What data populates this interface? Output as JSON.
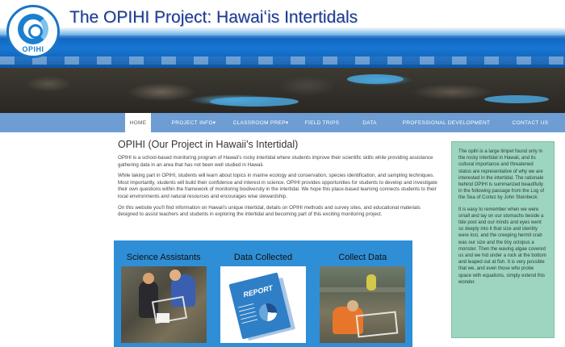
{
  "site": {
    "title": "The OPIHI Project: Hawaiʻis Intertidals",
    "logo_text": "OPIHI"
  },
  "nav": {
    "items": [
      {
        "label": "HOME",
        "active": true
      },
      {
        "label": "PROJECT INFO▾",
        "active": false
      },
      {
        "label": "CLASSROOM PREP▾",
        "active": false
      },
      {
        "label": "FIELD TRIPS",
        "active": false
      },
      {
        "label": "DATA",
        "active": false
      },
      {
        "label": "PROFESSIONAL DEVELOPMENT",
        "active": false
      },
      {
        "label": "CONTACT US",
        "active": false
      }
    ]
  },
  "main": {
    "title": "OPIHI (Our Project in Hawaii's Intertidal)",
    "paragraphs": [
      "OPIHI is a school-based monitoring program of Hawaii's rocky intertidal where students improve their scientific skills while providing assistance gathering data in an area that has not been well studied in Hawaii.",
      "While taking part in OPIHI, students will learn about topics in marine ecology and conservation, species identification, and sampling techniques. Most importantly, students will build their confidence and interest in science. OPIHI provides opportunities for students to develop and investigate their own questions within the framework of monitoring biodiversity in the intertidal. We hope this place-based learning connects students to their local environments and natural resources and encourages wise stewardship.",
      "On this website you'll find information on Hawaii's unique intertidal, details on OPIHI methods and survey sites, and educational materials designed to assist teachers and students in exploring the intertidal and becoming part of this exciting monitoring project."
    ]
  },
  "features": [
    {
      "title": "Science Assistants",
      "icon": "students-photo"
    },
    {
      "title": "Data Collected",
      "icon": "report-graphic",
      "image_text": "REPORT"
    },
    {
      "title": "Collect Data",
      "icon": "field-survey-photo"
    }
  ],
  "sidebar": {
    "paragraphs": [
      "The opihi is a large limpet found only in the rocky intertidal in Hawaii, and its cultural importance and threatened status are representative of why we are interested in the intertidal. The rationale behind OPIHI is summarized beautifully in the following passage from the Log of the Sea of Cortez by John Steinbeck:",
      "It is easy to remember when we were small and lay on our stomachs beside a tide pool and our minds and eyes went so deeply into it that size and identity were lost, and the creeping hermit crab was our size and the tiny octopus a monster. Then the waving algae covered us and we hid under a rock at the bottom and leaped out at fish. It is very possible that we, and even those who probe space with equations, simply extend this wonder."
    ]
  },
  "colors": {
    "nav_bg": "#6e9dd4",
    "feature_panel": "#2f8fd6",
    "sidebar_bg": "#9ed5c0",
    "title_color": "#1f3a8a"
  }
}
